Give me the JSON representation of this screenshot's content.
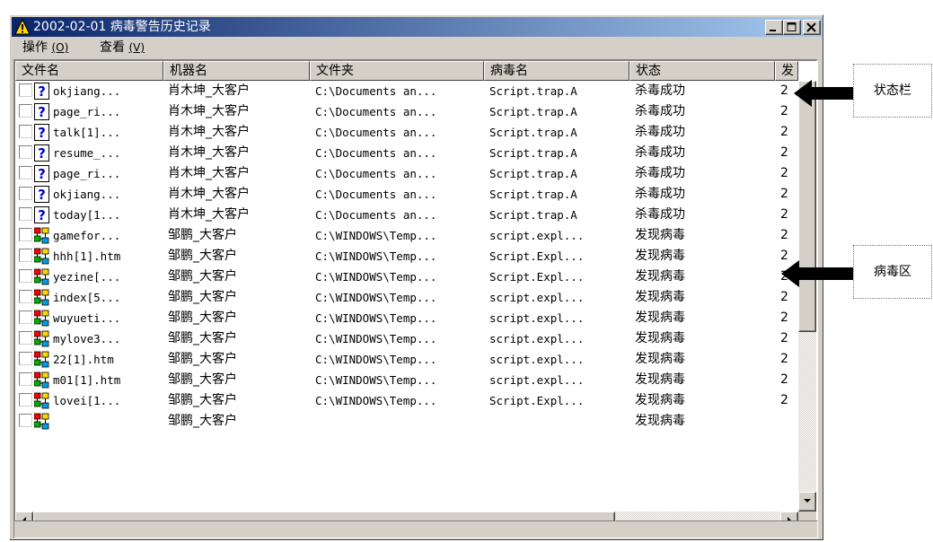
{
  "window": {
    "title": "2002-02-01 病毒警告历史记录",
    "menu": [
      {
        "label": "操作",
        "hotkey": "(O)"
      },
      {
        "label": "查看",
        "hotkey": "(V)"
      }
    ],
    "buttons": [
      "minimize-icon",
      "maximize-icon",
      "close-icon"
    ]
  },
  "columns": [
    "文件名",
    "机器名",
    "文件夹",
    "病毒名",
    "状态",
    "发"
  ],
  "rows": [
    {
      "file": "okjiang...",
      "machine": "肖木坤_大客户",
      "folder": "C:\\Documents an...",
      "virus": "Script.trap.A",
      "status": "杀毒成功",
      "extra": "2",
      "icon": "unknown-file-icon"
    },
    {
      "file": "page_ri...",
      "machine": "肖木坤_大客户",
      "folder": "C:\\Documents an...",
      "virus": "Script.trap.A",
      "status": "杀毒成功",
      "extra": "2",
      "icon": "unknown-file-icon"
    },
    {
      "file": "talk[1]...",
      "machine": "肖木坤_大客户",
      "folder": "C:\\Documents an...",
      "virus": "Script.trap.A",
      "status": "杀毒成功",
      "extra": "2",
      "icon": "unknown-file-icon"
    },
    {
      "file": "resume_...",
      "machine": "肖木坤_大客户",
      "folder": "C:\\Documents an...",
      "virus": "Script.trap.A",
      "status": "杀毒成功",
      "extra": "2",
      "icon": "unknown-file-icon"
    },
    {
      "file": "page_ri...",
      "machine": "肖木坤_大客户",
      "folder": "C:\\Documents an...",
      "virus": "Script.trap.A",
      "status": "杀毒成功",
      "extra": "2",
      "icon": "unknown-file-icon"
    },
    {
      "file": "okjiang...",
      "machine": "肖木坤_大客户",
      "folder": "C:\\Documents an...",
      "virus": "Script.trap.A",
      "status": "杀毒成功",
      "extra": "2",
      "icon": "unknown-file-icon"
    },
    {
      "file": "today[1...",
      "machine": "肖木坤_大客户",
      "folder": "C:\\Documents an...",
      "virus": "Script.trap.A",
      "status": "杀毒成功",
      "extra": "2",
      "icon": "unknown-file-icon"
    },
    {
      "file": "gamefor...",
      "machine": "邹鹏_大客户",
      "folder": "C:\\WINDOWS\\Temp...",
      "virus": "script.expl...",
      "status": "发现病毒",
      "extra": "2",
      "icon": "virus-file-icon"
    },
    {
      "file": "hhh[1].htm",
      "machine": "邹鹏_大客户",
      "folder": "C:\\WINDOWS\\Temp...",
      "virus": "Script.Expl...",
      "status": "发现病毒",
      "extra": "2",
      "icon": "virus-file-icon"
    },
    {
      "file": "yezine[...",
      "machine": "邹鹏_大客户",
      "folder": "C:\\WINDOWS\\Temp...",
      "virus": "Script.Expl...",
      "status": "发现病毒",
      "extra": "2",
      "icon": "virus-file-icon"
    },
    {
      "file": "index[5...",
      "machine": "邹鹏_大客户",
      "folder": "C:\\WINDOWS\\Temp...",
      "virus": "script.expl...",
      "status": "发现病毒",
      "extra": "2",
      "icon": "virus-file-icon"
    },
    {
      "file": "wuyueti...",
      "machine": "邹鹏_大客户",
      "folder": "C:\\WINDOWS\\Temp...",
      "virus": "script.expl...",
      "status": "发现病毒",
      "extra": "2",
      "icon": "virus-file-icon"
    },
    {
      "file": "mylove3...",
      "machine": "邹鹏_大客户",
      "folder": "C:\\WINDOWS\\Temp...",
      "virus": "script.expl...",
      "status": "发现病毒",
      "extra": "2",
      "icon": "virus-file-icon"
    },
    {
      "file": "22[1].htm",
      "machine": "邹鹏_大客户",
      "folder": "C:\\WINDOWS\\Temp...",
      "virus": "script.expl...",
      "status": "发现病毒",
      "extra": "2",
      "icon": "virus-file-icon"
    },
    {
      "file": "m01[1].htm",
      "machine": "邹鹏_大客户",
      "folder": "C:\\WINDOWS\\Temp...",
      "virus": "script.expl...",
      "status": "发现病毒",
      "extra": "2",
      "icon": "virus-file-icon"
    },
    {
      "file": "lovei[1...",
      "machine": "邹鹏_大客户",
      "folder": "C:\\WINDOWS\\Temp...",
      "virus": "Script.Expl...",
      "status": "发现病毒",
      "extra": "2",
      "icon": "virus-file-icon"
    },
    {
      "file": "",
      "machine": "邹鹏_大客户",
      "folder": "",
      "virus": "",
      "status": "发现病毒",
      "extra": "",
      "icon": "virus-file-icon"
    }
  ],
  "callouts": {
    "status_column": "状态栏",
    "virus_area": "病毒区"
  }
}
